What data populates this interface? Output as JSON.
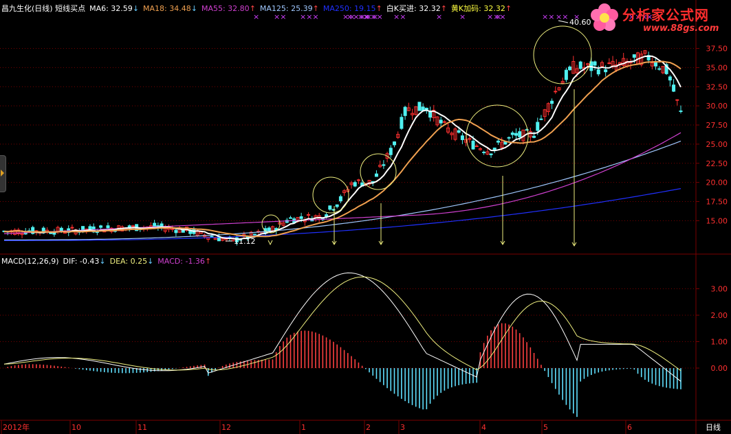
{
  "header": {
    "title": "昌九生化(日线) 短线买点",
    "ma6_label": "MA6: 32.59",
    "ma18_label": "MA18: 34.48",
    "ma55_label": "MA55: 32.80",
    "ma125_label": "MA125: 25.39",
    "ma250_label": "MA250: 19.15",
    "white_k_label": "白K买进: 32.32",
    "yellow_k_label": "黄K加码: 32.32",
    "arrow_down": "↓",
    "arrow_up": "↑"
  },
  "logo": {
    "name": "分析家公式网",
    "url": "www.88gs.com"
  },
  "macd_header": {
    "title": "MACD(12,26,9)",
    "dif": "DIF: -0.43",
    "dea": "DEA: 0.25",
    "macd": "MACD: -1.36"
  },
  "price_axis": [
    "37.50",
    "35.00",
    "32.50",
    "30.00",
    "27.50",
    "25.00",
    "22.50",
    "20.00",
    "17.50",
    "15.00"
  ],
  "macd_axis": [
    "3.00",
    "2.00",
    "1.00",
    "0.00"
  ],
  "time_axis": [
    "2012年",
    "10",
    "11",
    "12",
    "1",
    "2",
    "3",
    "4",
    "5",
    "6"
  ],
  "period_label": "日线",
  "annotations": {
    "high": "40.60",
    "low": "11.12"
  },
  "signal_marks": [
    "×",
    "××",
    "×××",
    "××",
    "×××××",
    "××××",
    "×",
    "××",
    "×",
    "×",
    "×××",
    "×",
    "××",
    "××",
    "×",
    "×××",
    "×"
  ],
  "colors": {
    "bg": "#000000",
    "grid": "#7a0000",
    "ma6": "#ffffff",
    "ma18": "#f0a050",
    "ma55": "#d040d0",
    "ma125": "#a0c8ff",
    "ma250": "#2030ff",
    "up": "#ff3030",
    "down": "#50f0f0",
    "dif": "#ffffff",
    "dea": "#f0f080",
    "hist_up": "#ff4040",
    "hist_down": "#60e0ff",
    "axis_text": "#ff3030"
  }
}
